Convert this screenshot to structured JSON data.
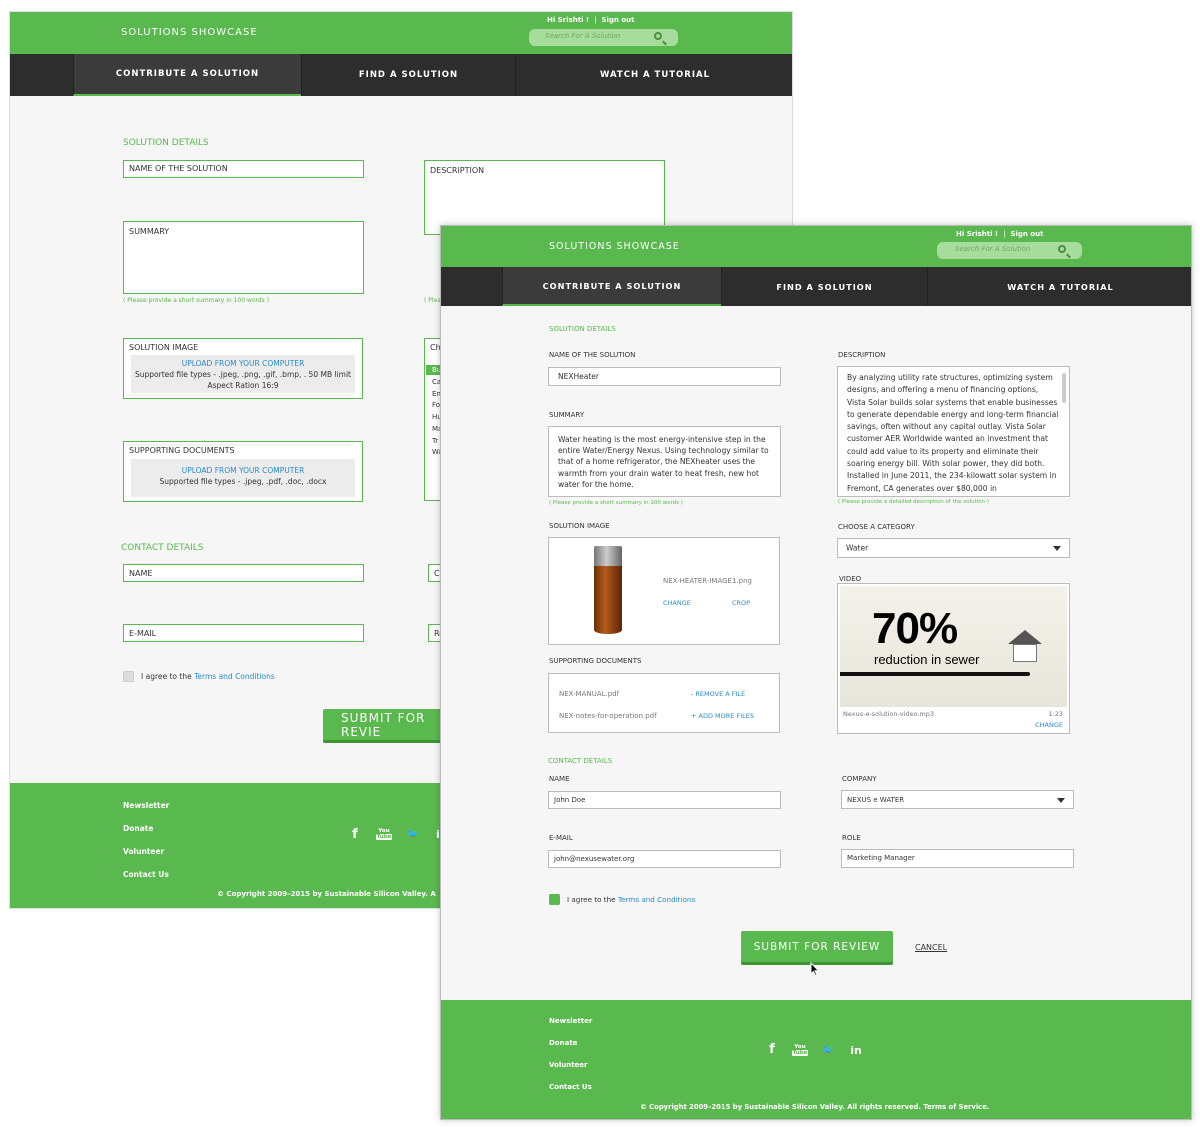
{
  "brand": "SOLUTIONS SHOWCASE",
  "header": {
    "greeting": "Hi Srishti !",
    "separator": "|",
    "signout": "Sign out",
    "search_placeholder": "Search For A Solution"
  },
  "nav": {
    "tabs": [
      "CONTRIBUTE A SOLUTION",
      "FIND A SOLUTION",
      "WATCH A TUTORIAL"
    ],
    "active": "CONTRIBUTE A SOLUTION"
  },
  "back": {
    "solution_details": "SOLUTION DETAILS",
    "name_label": "NAME OF THE SOLUTION",
    "description_label": "DESCRIPTION",
    "summary_label": "SUMMARY",
    "summary_hint": "( Please provide a short summary in 100 words )",
    "hint_fragment": "( Plea",
    "image_label": "SOLUTION IMAGE",
    "upload": "UPLOAD FROM YOUR COMPUTER",
    "image_types": "Supported file types - .jpeg, .png, .gif, .bmp, . 50 MB limit",
    "image_aspect": "Aspect Ration 16:9",
    "choose_fragment": "Ch",
    "cat_selected": "Bu",
    "cat_fragments": [
      "Ca",
      "En",
      "Fo",
      "Hu",
      "Ma",
      "Tr",
      "Wa"
    ],
    "docs_label": "SUPPORTING DOCUMENTS",
    "docs_types": "Supported file types - .jpeg, .pdf, .doc, .docx",
    "contact_details": "CONTACT DETAILS",
    "name": "NAME",
    "email": "E-MAIL",
    "company_fragment": "Co",
    "role_fragment": "Ro",
    "agree": "I agree to the",
    "terms": "Terms and Conditions",
    "submit_fragment": "SUBMIT FOR REVIE"
  },
  "form": {
    "solution_details": "SOLUTION DETAILS",
    "name_label": "NAME OF THE SOLUTION",
    "name_value": "NEXHeater",
    "description_label": "DESCRIPTION",
    "description_value": "By analyzing utility rate structures, optimizing system designs, and offering a menu of financing options, Vista Solar builds solar systems that enable businesses to generate dependable energy and long-term financial savings, often without any capital outlay. Vista Solar customer AER Worldwide wanted an investment that could add value to its property and eliminate their soaring energy bill. With solar power, they did both. Installed in June 2011, the 234-kilowatt solar system in Fremont, CA generates over $80,000 in",
    "description_hint": "( Please provide a detailed description of the solution )",
    "summary_label": "SUMMARY",
    "summary_value": "Water heating is the most energy-intensive step in the entire Water/Energy Nexus. Using technology similar to that of a home refrigerator, the NEXheater uses the warmth from your drain water to heat fresh, new hot water for the home.",
    "summary_hint": "( Please provide a short summary in 100 words )",
    "image_label": "SOLUTION IMAGE",
    "image_file": "NEX-HEATER-IMAGE1.png",
    "change": "CHANGE",
    "crop": "CROP",
    "category_label": "CHOOSE A CATEGORY",
    "category_value": "Water",
    "video_label": "VIDEO",
    "video_big": "70%",
    "video_caption": "reduction in sewer",
    "video_file": "Nexus-e-solution-video.mp3",
    "video_duration": "1:23",
    "video_change": "CHANGE",
    "docs_label": "SUPPORTING DOCUMENTS",
    "doc1": "NEX-MANUAL.pdf",
    "doc2": "NEX-notes-for-operation.pdf",
    "remove": "- REMOVE A FILE",
    "add_more": "+ ADD MORE FILES",
    "contact_details": "CONTACT DETAILS",
    "name_label2": "NAME",
    "name2": "John Doe",
    "company_label": "COMPANY",
    "company_value": "NEXUS e WATER",
    "email_label": "E-MAIL",
    "email_value": "john@nexusewater.org",
    "role_label": "ROLE",
    "role_value": "Marketing Manager",
    "agree": "I agree to the",
    "terms": "Terms and Conditions",
    "submit": "SUBMIT FOR REVIEW",
    "cancel": "CANCEL"
  },
  "footer": {
    "links": [
      "Newsletter",
      "Donate",
      "Volunteer",
      "Contact Us"
    ],
    "social": [
      "facebook-icon",
      "youtube-icon",
      "twitter-icon",
      "linkedin-icon"
    ],
    "fb": "f",
    "yt_top": "You",
    "yt_bottom": "Tube",
    "tw": "🐦",
    "in": "in",
    "copyright": "© Copyright 2009–2015 by Sustainable Silicon Valley. All rights reserved. Terms of Service.",
    "copyright_partial": "© Copyright 2009–2015 by Sustainable Silicon Valley. A"
  },
  "colors": {
    "brand": "#5ab94e",
    "nav": "#2d2d2d",
    "link": "#2b8acb"
  }
}
